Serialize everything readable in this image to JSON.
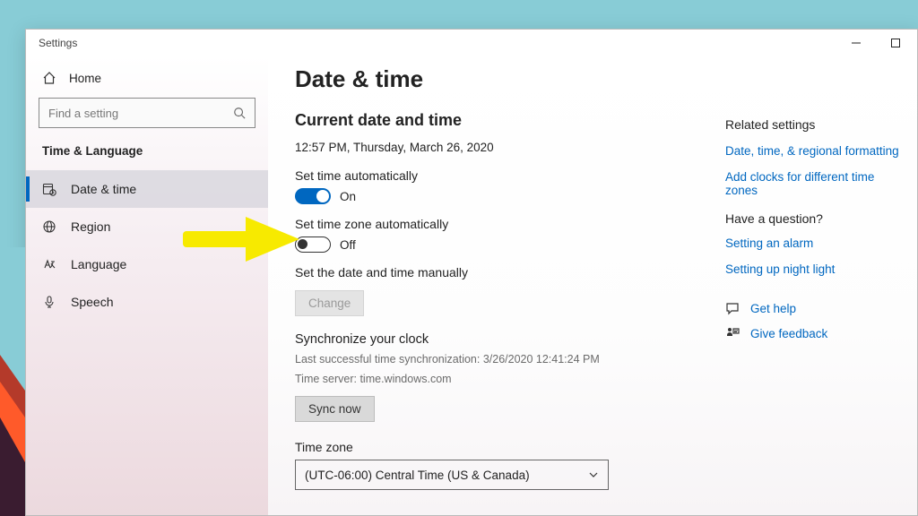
{
  "window": {
    "app_title": "Settings"
  },
  "sidebar": {
    "home": "Home",
    "search_placeholder": "Find a setting",
    "category": "Time & Language",
    "items": [
      {
        "label": "Date & time",
        "selected": true
      },
      {
        "label": "Region"
      },
      {
        "label": "Language"
      },
      {
        "label": "Speech"
      }
    ]
  },
  "main": {
    "title": "Date & time",
    "subtitle": "Current date and time",
    "now": "12:57 PM, Thursday, March 26, 2020",
    "set_time_auto_label": "Set time automatically",
    "set_time_auto_state": "On",
    "set_tz_auto_label": "Set time zone automatically",
    "set_tz_auto_state": "Off",
    "manual_label": "Set the date and time manually",
    "change_btn": "Change",
    "sync_heading": "Synchronize your clock",
    "sync_last": "Last successful time synchronization: 3/26/2020 12:41:24 PM",
    "sync_server": "Time server: time.windows.com",
    "sync_btn": "Sync now",
    "tz_label": "Time zone",
    "tz_value": "(UTC-06:00) Central Time (US & Canada)"
  },
  "right": {
    "related_title": "Related settings",
    "related_links": [
      "Date, time, & regional formatting",
      "Add clocks for different time zones"
    ],
    "question_title": "Have a question?",
    "question_links": [
      "Setting an alarm",
      "Setting up night light"
    ],
    "get_help": "Get help",
    "give_feedback": "Give feedback"
  }
}
